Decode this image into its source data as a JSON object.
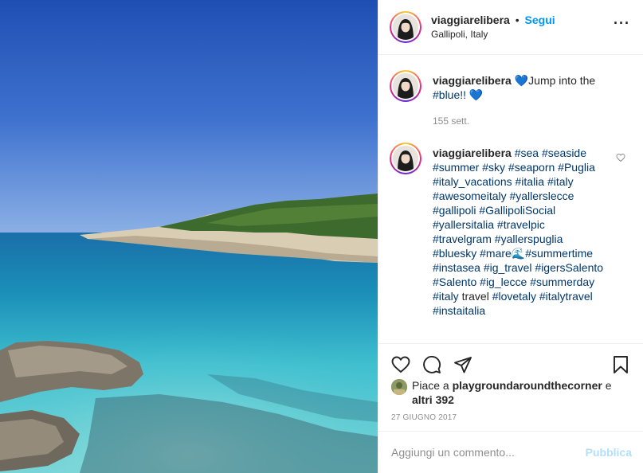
{
  "header": {
    "username": "viaggiarelibera",
    "separator": "•",
    "follow_label": "Segui",
    "location": "Gallipoli, Italy",
    "more_icon": "more-horizontal-icon"
  },
  "caption": {
    "username": "viaggiarelibera",
    "heart_emoji": "💙",
    "text": "Jump into the ",
    "hashtag": "#blue!!",
    "trailing": " 💙",
    "time": "155 sett."
  },
  "comment": {
    "username": "viaggiarelibera",
    "hashtags": "#sea #seaside #summer #sky #seaporn #Puglia #italy_vacations #italia #italy #awesomeitaly #yallerslecce #gallipoli #GallipoliSocial #yallersitalia #travelpic #travelgram #yallerspuglia #bluesky #mare🌊#summertime #instasea #ig_travel #igersSalento #Salento #ig_lecce #summerday #italy",
    "plain_word": "travel",
    "hashtags_end": "#lovetaly #italytravel #instaitalia",
    "like_icon": "heart-outline-icon"
  },
  "actions": {
    "like_icon": "heart-icon",
    "comment_icon": "comment-icon",
    "share_icon": "share-icon",
    "save_icon": "bookmark-icon"
  },
  "likes": {
    "prefix": "Piace a ",
    "user": "playgroundaroundthecorner",
    "middle": " e ",
    "others": "altri 392"
  },
  "date": "27 GIUGNO 2017",
  "add_comment": {
    "placeholder": "Aggiungi un commento...",
    "publish_label": "Pubblica"
  },
  "colors": {
    "link_blue": "#0095f6",
    "hashtag": "#00376b",
    "muted": "#8e8e8e",
    "publish_disabled": "#b2dffc"
  }
}
